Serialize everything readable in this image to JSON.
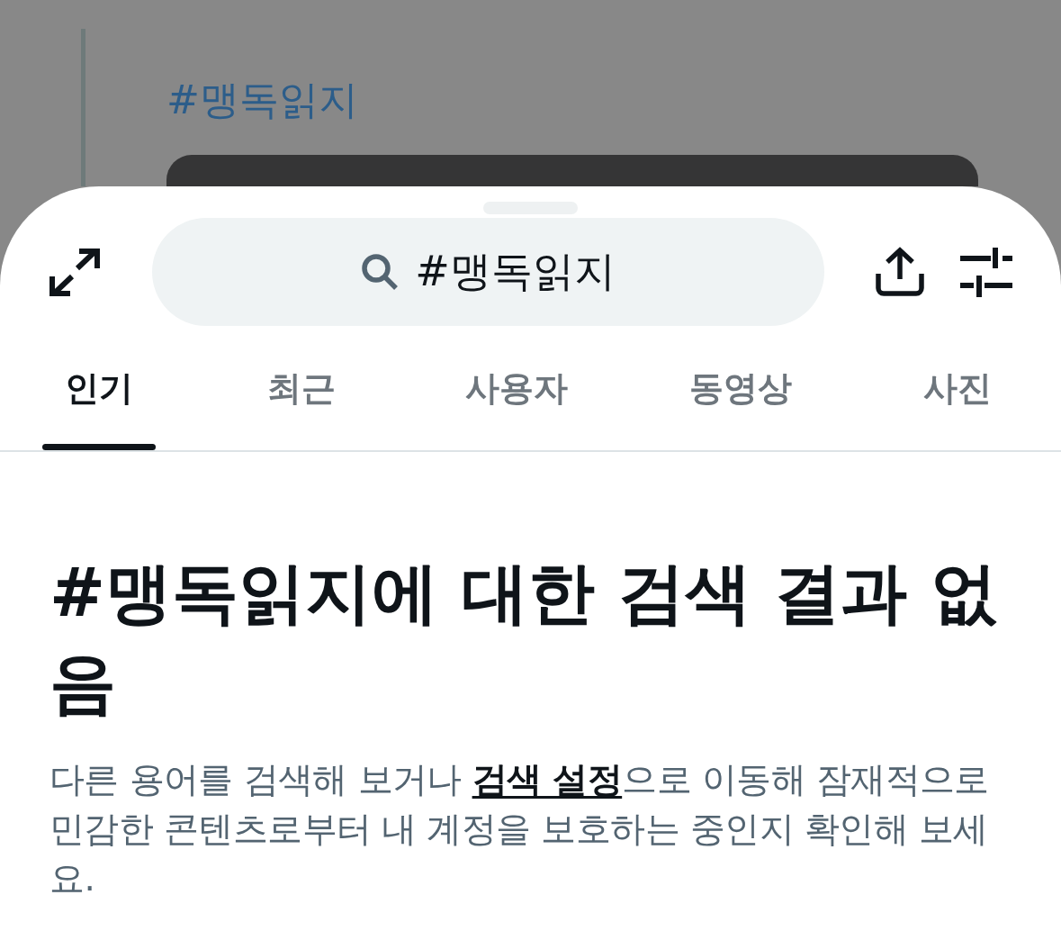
{
  "backdrop": {
    "hashtag": "#맹독읽지"
  },
  "sheet": {
    "search": {
      "value": "#맹독읽지"
    },
    "tabs": [
      {
        "label": "인기",
        "selected": true
      },
      {
        "label": "최근",
        "selected": false
      },
      {
        "label": "사용자",
        "selected": false
      },
      {
        "label": "동영상",
        "selected": false
      },
      {
        "label": "사진",
        "selected": false
      }
    ],
    "empty_state": {
      "title": "#맹독읽지에 대한 검색 결과 없음",
      "message": {
        "before": "다른 용어를 검색해 보거나 ",
        "link": "검색 설정",
        "after": "으로 이동해 잠재적으로 민감한 콘텐츠로부터 내 계정을 보호하는 중인지 확인해 보세요."
      }
    }
  }
}
